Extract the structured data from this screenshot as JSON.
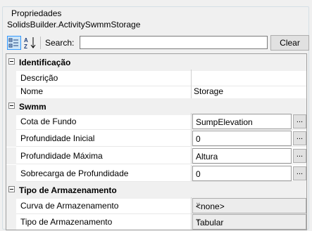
{
  "window": {
    "group_title": "Propriedades",
    "object_name": "SolidsBuilder.ActivitySwmmStorage"
  },
  "toolbar": {
    "categorized_icon": "categorized-view-icon",
    "alphabetical_icon": "alphabetical-sort-icon",
    "search_label": "Search:",
    "search_value": "",
    "clear_label": "Clear"
  },
  "grid": {
    "categories": [
      {
        "label": "Identificação",
        "properties": [
          {
            "name": "Descrição",
            "value": ""
          },
          {
            "name": "Nome",
            "value": "Storage"
          }
        ]
      },
      {
        "label": "Swmm",
        "properties": [
          {
            "name": "Cota de Fundo",
            "value": "SumpElevation",
            "editor": "..."
          },
          {
            "name": "Profundidade Inicial",
            "value": "0",
            "editor": "..."
          },
          {
            "name": "Profundidade Máxima",
            "value": "Altura",
            "editor": "..."
          },
          {
            "name": "Sobrecarga de Profundidade",
            "value": "0",
            "editor": "..."
          }
        ]
      },
      {
        "label": "Tipo de Armazenamento",
        "properties": [
          {
            "name": "Curva de Armazenamento",
            "value": "<none>"
          },
          {
            "name": "Tipo de Armazenamento",
            "value": "Tabular"
          }
        ]
      }
    ]
  }
}
